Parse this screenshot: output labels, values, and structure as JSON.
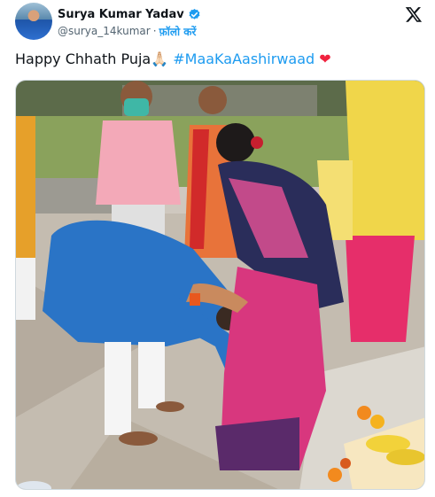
{
  "author": {
    "display_name": "Surya Kumar Yadav",
    "handle": "@surya_14kumar",
    "separator": "·",
    "follow_label": "फ़ॉलो करें",
    "verified": true
  },
  "tweet": {
    "text_prefix": "Happy Chhath Puja",
    "emoji": "🙏🏻",
    "hashtag": "#MaaKaAashirwaad",
    "heart": "❤"
  },
  "media": {
    "description_icon": "photo"
  },
  "colors": {
    "accent": "#1d9bf0",
    "text": "#0f1419",
    "muted": "#536471",
    "heart": "#f0223e"
  }
}
